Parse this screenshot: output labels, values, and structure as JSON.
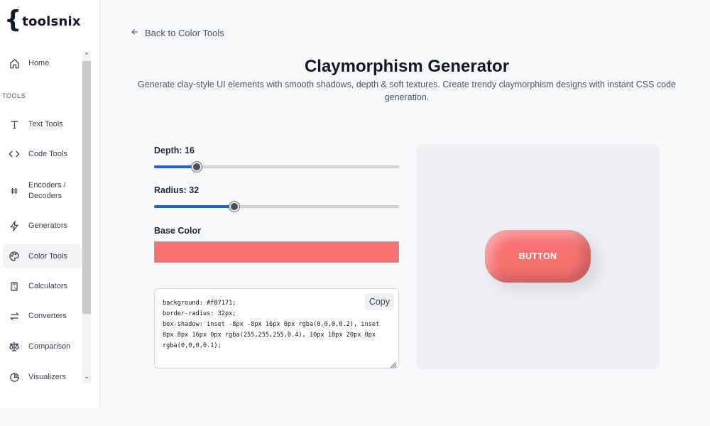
{
  "brand": {
    "brace": "{",
    "name": "toolsnix"
  },
  "sidebar": {
    "section_label": "TOOLS",
    "items": [
      {
        "label": "Home",
        "icon": "home-icon"
      },
      {
        "label": "Text Tools",
        "icon": "text-icon"
      },
      {
        "label": "Code Tools",
        "icon": "code-icon"
      },
      {
        "label": "Encoders /\nDecoders",
        "icon": "binary-icon"
      },
      {
        "label": "Generators",
        "icon": "bolt-icon"
      },
      {
        "label": "Color Tools",
        "icon": "palette-icon"
      },
      {
        "label": "Calculators",
        "icon": "calculator-icon"
      },
      {
        "label": "Converters",
        "icon": "swap-icon"
      },
      {
        "label": "Comparison",
        "icon": "scale-icon"
      },
      {
        "label": "Visualizers",
        "icon": "pie-chart-icon"
      }
    ],
    "active": "Color Tools"
  },
  "back_link": "Back to Color Tools",
  "page": {
    "title": "Claymorphism Generator",
    "subtitle": "Generate clay-style UI elements with smooth shadows, depth & soft textures. Create trendy claymorphism designs with instant CSS code generation."
  },
  "controls": {
    "depth_label": "Depth: 16",
    "depth_value": 16,
    "depth_fill": 0.175,
    "radius_label": "Radius: 32",
    "radius_value": 32,
    "radius_fill": 0.327,
    "base_color_label": "Base Color",
    "base_color": "#f87171"
  },
  "code": {
    "text": "background: #f87171;\nborder-radius: 32px;\nbox-shadow: inset -8px -8px 16px 0px rgba(0,0,0,0.2), inset 8px 8px 16px 0px rgba(255,255,255,0.4), 10px 10px 20px 0px rgba(0,0,0,0.1);",
    "copy_label": "Copy"
  },
  "preview": {
    "button_label": "BUTTON"
  },
  "colors": {
    "accent": "#1a65d6",
    "clay": "#f87171"
  }
}
